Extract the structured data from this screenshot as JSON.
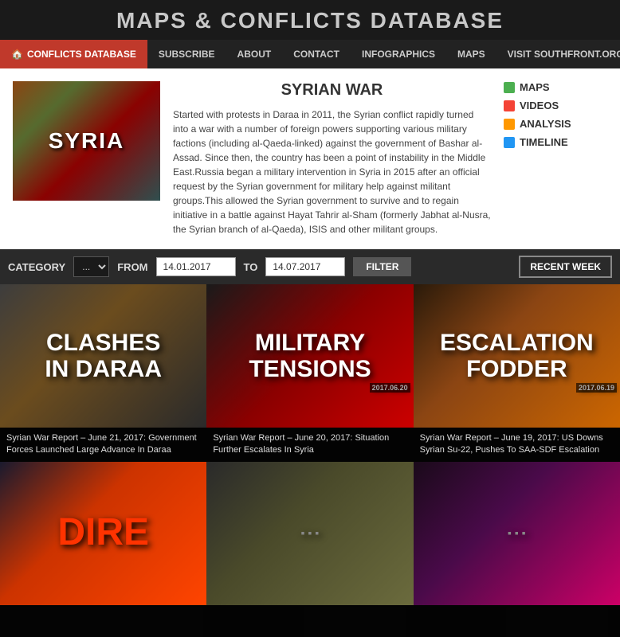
{
  "header": {
    "title": "MAPS & CONFLICTS DATABASE"
  },
  "nav": {
    "items": [
      {
        "label": "CONFLICTS DATABASE",
        "active": true,
        "id": "conflicts-database"
      },
      {
        "label": "SUBSCRIBE",
        "active": false,
        "id": "subscribe"
      },
      {
        "label": "ABOUT",
        "active": false,
        "id": "about"
      },
      {
        "label": "CONTACT",
        "active": false,
        "id": "contact"
      },
      {
        "label": "INFOGRAPHICS",
        "active": false,
        "id": "infographics"
      },
      {
        "label": "MAPS",
        "active": false,
        "id": "maps"
      },
      {
        "label": "VISIT SOUTHFRONT.ORG",
        "active": false,
        "id": "visit-southfront"
      }
    ]
  },
  "war_section": {
    "title": "SYRIAN WAR",
    "description": "Started with protests in Daraa in 2011, the Syrian conflict rapidly turned into a war with a number of foreign powers supporting various military factions (including al-Qaeda-linked) against the government of Bashar al-Assad. Since then, the country has been a point of instability in the Middle East.Russia began a military intervention in Syria in 2015 after an official request by the Syrian government for military help against militant groups.This allowed the Syrian government to survive and to regain initiative in a battle against Hayat Tahrir al-Sham (formerly Jabhat al-Nusra, the Syrian branch of al-Qaeda), ISIS and other militant groups.",
    "thumbnail_text": "SYRIA",
    "sidebar": [
      {
        "label": "MAPS",
        "color": "green"
      },
      {
        "label": "VIDEOS",
        "color": "red"
      },
      {
        "label": "ANALYSIS",
        "color": "orange"
      },
      {
        "label": "TIMELINE",
        "color": "blue"
      }
    ]
  },
  "filter": {
    "category_label": "CATEGORY",
    "category_value": "...",
    "from_label": "FROM",
    "from_value": "14.01.2017",
    "to_label": "TO",
    "to_value": "14.07.2017",
    "filter_btn": "FILTER",
    "recent_week_btn": "RECENT WEEK"
  },
  "articles": [
    {
      "id": "article-1",
      "img_text": "CLASHES\nIN DARAA",
      "caption": "Syrian War Report – June 21, 2017: Government Forces Launched Large Advance In Daraa",
      "date": "",
      "style": "clashes"
    },
    {
      "id": "article-2",
      "img_text": "MILITARY\nTENSIONS",
      "caption": "Syrian War Report – June 20, 2017: Situation Further Escalates In Syria",
      "date": "2017.06.20",
      "style": "military"
    },
    {
      "id": "article-3",
      "img_text": "ESCALATION\nFODDER",
      "caption": "Syrian War Report – June 19, 2017: US Downs Syrian Su-22, Pushes To SAA-SDF Escalation",
      "date": "2017.06.19",
      "style": "escalation"
    },
    {
      "id": "article-4",
      "img_text": "DIRECT",
      "caption": "",
      "date": "",
      "style": "direct"
    },
    {
      "id": "article-5",
      "img_text": "",
      "caption": "",
      "date": "",
      "style": "tanks"
    },
    {
      "id": "article-6",
      "img_text": "",
      "caption": "",
      "date": "",
      "style": "last"
    }
  ]
}
